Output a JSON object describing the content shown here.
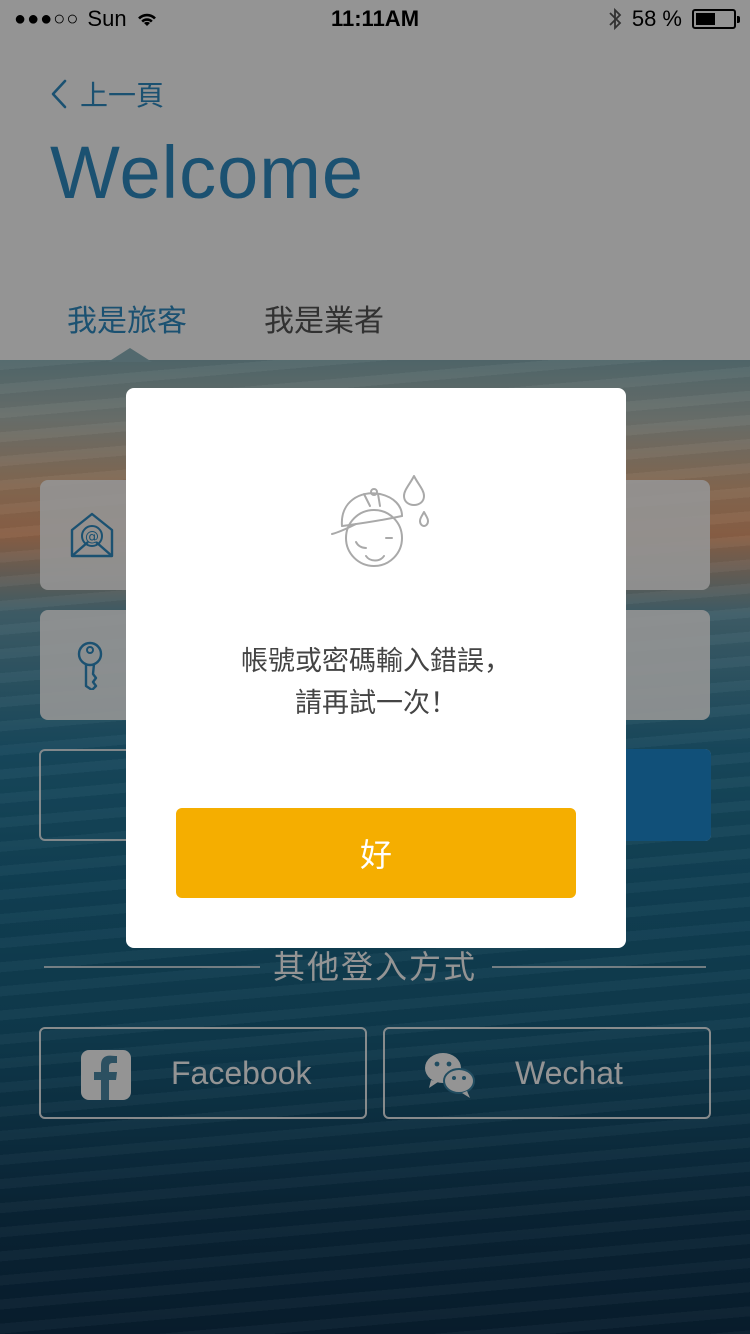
{
  "status_bar": {
    "signal": "●●●○○",
    "carrier": "Sun",
    "time": "11:11AM",
    "battery_text": "58 %",
    "battery_level": 0.58
  },
  "header": {
    "back_label": "上一頁",
    "title": "Welcome",
    "tabs": [
      {
        "label": "我是旅客",
        "active": true
      },
      {
        "label": "我是業者",
        "active": false
      }
    ]
  },
  "login": {
    "email_icon": "email-at-icon",
    "password_icon": "key-icon",
    "other_login_label": "其他登入方式",
    "social": [
      {
        "label": "Facebook",
        "icon": "facebook-icon"
      },
      {
        "label": "Wechat",
        "icon": "wechat-icon"
      }
    ]
  },
  "dialog": {
    "message_line1": "帳號或密碼輸入錯誤，",
    "message_line2": "請再試一次！",
    "ok_label": "好",
    "illustration": "sweating-face-cap-icon"
  },
  "colors": {
    "accent": "#2f8cc3",
    "ok_button": "#f5ae00",
    "primary_button": "#1e8bd0"
  }
}
